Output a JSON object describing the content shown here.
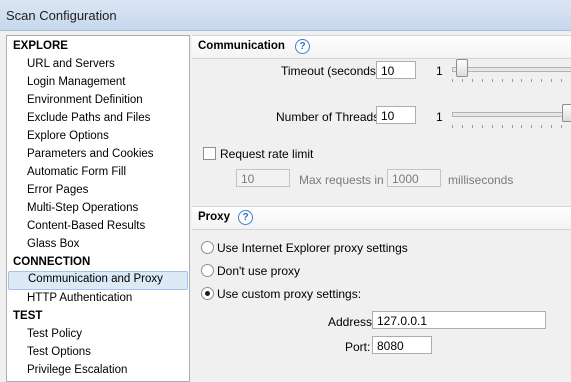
{
  "window": {
    "title": "Scan Configuration"
  },
  "sidebar": {
    "explore": {
      "label": "EXPLORE",
      "items": [
        "URL and Servers",
        "Login Management",
        "Environment Definition",
        "Exclude Paths and Files",
        "Explore Options",
        "Parameters and Cookies",
        "Automatic Form Fill",
        "Error Pages",
        "Multi-Step Operations",
        "Content-Based Results",
        "Glass Box"
      ]
    },
    "connection": {
      "label": "CONNECTION",
      "items": [
        "Communication and Proxy",
        "HTTP Authentication"
      ],
      "selected": "Communication and Proxy"
    },
    "test": {
      "label": "TEST",
      "items": [
        "Test Policy",
        "Test Options",
        "Privilege Escalation"
      ]
    }
  },
  "communication": {
    "title": "Communication",
    "timeout": {
      "label": "Timeout (seconds):",
      "value": "10",
      "slider_min": "1",
      "slider_position": 0.0
    },
    "threads": {
      "label": "Number of Threads:",
      "value": "10",
      "slider_min": "1",
      "slider_position": 1.0
    },
    "rate_limit": {
      "label": "Request rate limit",
      "checked": false,
      "requests_value": "10",
      "max_label": "Max requests in",
      "ms_value": "1000",
      "ms_label": "milliseconds"
    }
  },
  "proxy": {
    "title": "Proxy",
    "options": [
      {
        "label": "Use Internet Explorer proxy settings",
        "selected": false
      },
      {
        "label": "Don't use proxy",
        "selected": false
      },
      {
        "label": "Use custom proxy settings:",
        "selected": true
      }
    ],
    "address": {
      "label": "Address:",
      "value": "127.0.0.1"
    },
    "port": {
      "label": "Port:",
      "value": "8080"
    }
  },
  "icons": {
    "help": "help-icon",
    "help_glyph": "?"
  }
}
